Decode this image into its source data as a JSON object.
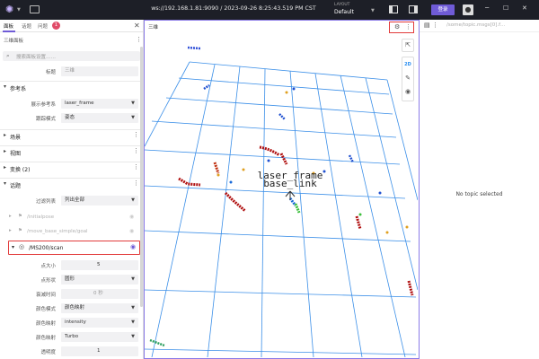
{
  "app": {
    "title": "ws://192.168.1.81:9090 / 2023-09-26 8:25:43.519 PM CST",
    "layout_label": "LAYOUT",
    "layout_value": "Default",
    "login_label": "登录"
  },
  "left_panel": {
    "tabs": [
      "面板",
      "话题",
      "问题"
    ],
    "problem_count": "1",
    "title": "三维面板",
    "search_placeholder": "搜索面板设置……",
    "title_label": "标题",
    "title_value": "三维",
    "sections": {
      "reference": "参考系",
      "scene": "场景",
      "view": "视图",
      "transforms": "变换 (2)",
      "topics": "话题"
    },
    "reference_rows": [
      {
        "label": "展示参考系",
        "value": "laser_frame"
      },
      {
        "label": "跟踪模式",
        "value": "姿态"
      }
    ],
    "topic_list_label": "过滤列表",
    "topic_list_value": "列出全部",
    "topics": [
      "/initialpose",
      "/move_base_simple/goal"
    ],
    "scan_topic": "/MS200/scan",
    "scan_rows": [
      {
        "label": "点大小",
        "value": "5"
      },
      {
        "label": "点形状",
        "value": "圆形"
      },
      {
        "label": "衰减时间",
        "value": "0  秒"
      },
      {
        "label": "颜色模式",
        "value": "颜色映射"
      },
      {
        "label": "颜色映射",
        "value": "intensity"
      },
      {
        "label": "颜色映射",
        "value": "Turbo"
      },
      {
        "label": "透明度",
        "value": "1"
      }
    ]
  },
  "viewport": {
    "title": "三维",
    "frame_labels": [
      "laser_frame",
      "base_link"
    ],
    "tool_2d": "2D"
  },
  "right_panel": {
    "topic_placeholder": "/some/topic.msgs[0].f…",
    "empty_text": "No topic selected"
  },
  "colors": {
    "accent": "#6f5bd6",
    "highlight": "#e23b3b",
    "grid": "#3b8fe8"
  }
}
